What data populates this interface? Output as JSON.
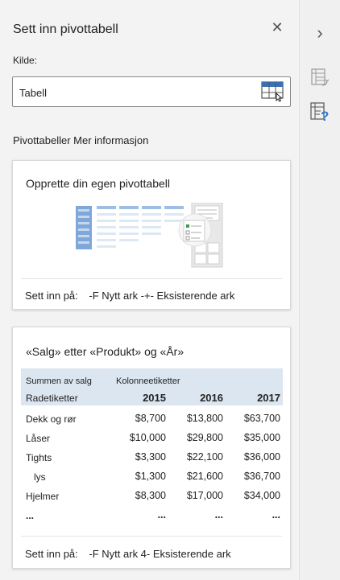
{
  "pane": {
    "title": "Sett inn pivottabell",
    "close_glyph": "✕",
    "source_label": "Kilde:",
    "source_value": "Tabell",
    "links_text": "Pivottabeller Mer informasjon"
  },
  "card_custom": {
    "title": "Opprette din egen pivottabell",
    "insert_label": "Sett inn på:",
    "insert_options": "-F Nytt ark -+- Eksisterende ark"
  },
  "card_suggest": {
    "title": "«Salg» etter «Produkt» og «År»",
    "header_sum": "Summen av salg",
    "header_col": "Kolonneetiketter",
    "header_row": "Radetiketter",
    "years": [
      "2015",
      "2016",
      "2017"
    ],
    "rows": [
      {
        "label": "Dekk og rør",
        "values": [
          "$8,700",
          "$13,800",
          "$63,700"
        ]
      },
      {
        "label": "Låser",
        "values": [
          "$10,000",
          "$29,800",
          "$35,000"
        ]
      },
      {
        "label": "Tights",
        "values": [
          "$3,300",
          "$22,100",
          "$36,000"
        ]
      },
      {
        "label": "lys",
        "values": [
          "$1,300",
          "$21,600",
          "$36,700"
        ]
      },
      {
        "label": "Hjelmer",
        "values": [
          "$8,300",
          "$17,000",
          "$34,000"
        ]
      },
      {
        "label": "...",
        "values": [
          "...",
          "...",
          "..."
        ]
      }
    ],
    "insert_label": "Sett inn på:",
    "insert_options": "-F Nytt ark 4- Eksisterende ark"
  },
  "rail": {
    "collapse_glyph": "›"
  },
  "colors": {
    "accent": "#2b7cd3",
    "header_fill": "#dce6f1"
  }
}
